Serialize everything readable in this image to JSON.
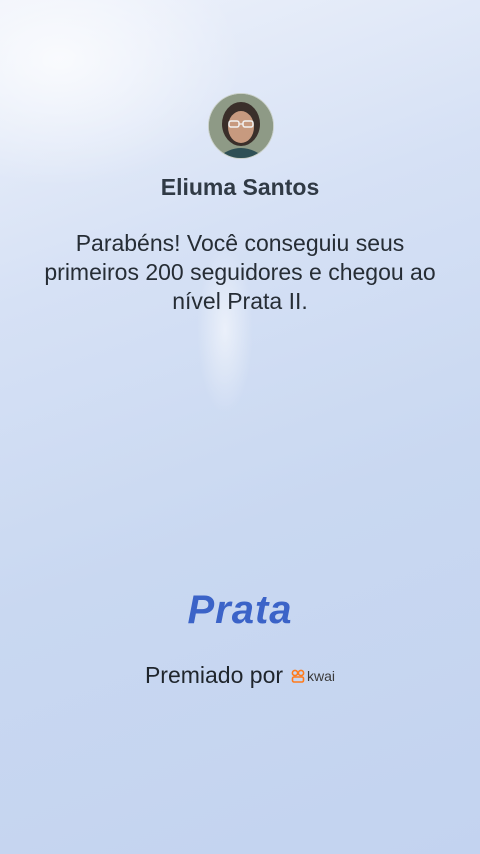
{
  "user": {
    "name": "Eliuma Santos"
  },
  "message": "Parabéns! Você conseguiu seus primeiros 200 seguidores e chegou ao nível Prata II.",
  "level": "Prata",
  "awarded": {
    "label": "Premiado por",
    "brand_name": "kwai",
    "brand_icon": "kwai-logo-icon",
    "brand_color": "#ff7a1a"
  },
  "colors": {
    "level": "#3b63c8",
    "background": "#c9d8f1"
  }
}
